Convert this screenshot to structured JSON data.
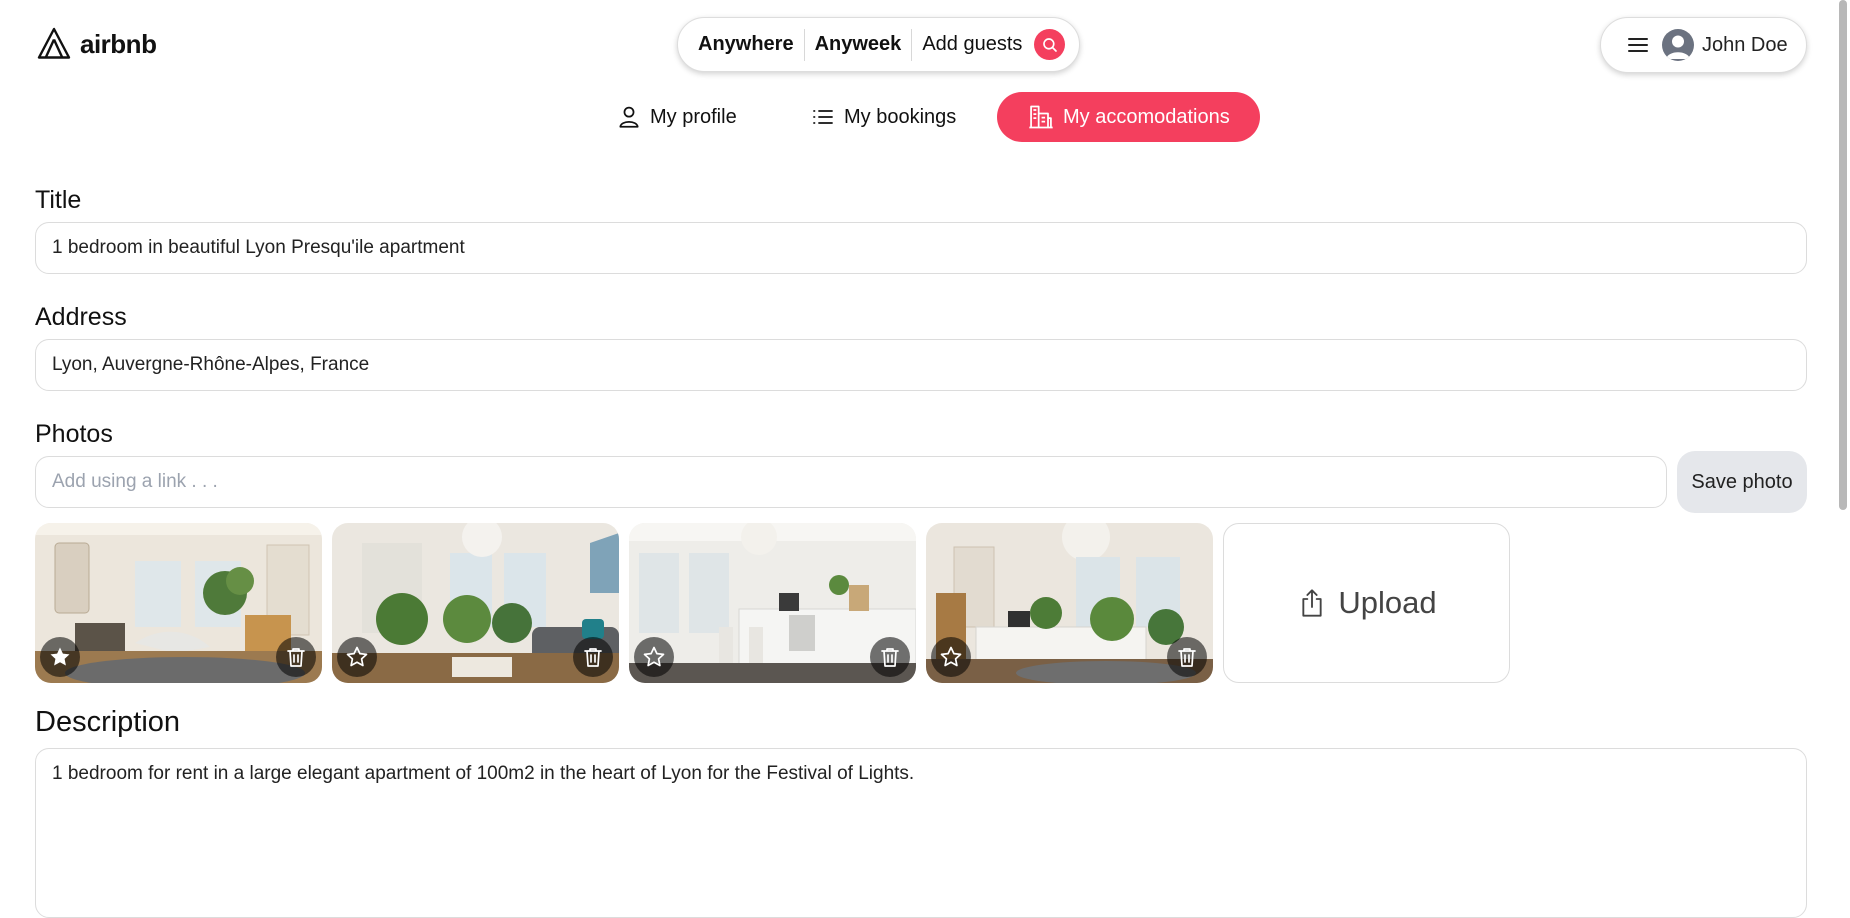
{
  "header": {
    "brand": "airbnb",
    "search": {
      "where": "Anywhere",
      "when": "Anyweek",
      "guests": "Add guests"
    },
    "user": {
      "name": "John Doe"
    }
  },
  "tabs": [
    {
      "label": "My profile",
      "icon": "user-icon",
      "active": false
    },
    {
      "label": "My bookings",
      "icon": "list-icon",
      "active": false
    },
    {
      "label": "My accomodations",
      "icon": "buildings-icon",
      "active": true
    }
  ],
  "form": {
    "title_label": "Title",
    "title_value": "1 bedroom in beautiful Lyon Presqu'ile apartment",
    "address_label": "Address",
    "address_value": "Lyon, Auvergne-Rhône-Alpes, France",
    "photos_label": "Photos",
    "photo_link_placeholder": "Add using a link . . .",
    "save_photo_label": "Save photo",
    "upload_label": "Upload",
    "description_label": "Description",
    "description_value": "1 bedroom for rent in a large elegant apartment of 100m2 in the heart of Lyon for the Festival of Lights."
  },
  "photos": [
    {
      "alt": "living room",
      "is_main": true
    },
    {
      "alt": "living room with sofa",
      "is_main": false
    },
    {
      "alt": "kitchen",
      "is_main": false
    },
    {
      "alt": "living room with plants",
      "is_main": false
    }
  ],
  "colors": {
    "accent": "#f43f5e",
    "border": "#dcdcdc",
    "button_gray": "#e5e7eb"
  }
}
